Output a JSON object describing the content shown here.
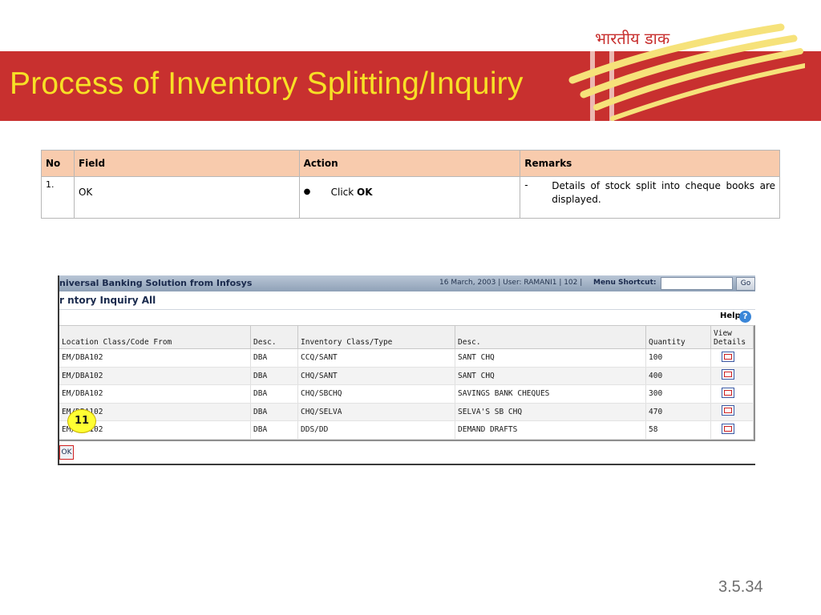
{
  "slide": {
    "title": "Process of Inventory Splitting/Inquiry",
    "logo_text": "भारतीय डाक",
    "page_number": "3.5.34",
    "colors": {
      "header_band": "#c8302f",
      "title_text": "#f7e026",
      "table_header": "#f8cbad"
    }
  },
  "instructions": {
    "headers": {
      "no": "No",
      "field": "Field",
      "action": "Action",
      "remarks": "Remarks"
    },
    "rows": [
      {
        "no": "1.",
        "field": "OK",
        "action_prefix": "Click ",
        "action_bold": "OK",
        "remark_dash": "-",
        "remark": "Details of stock split into cheque books are displayed."
      }
    ]
  },
  "app": {
    "title": "niversal Banking Solution from Infosys",
    "info": "16 March, 2003  |  User:  RAMANI1  |  102  |",
    "menu_shortcut_label": "Menu Shortcut:",
    "go_label": "Go",
    "subtitle": "r    ntory Inquiry All",
    "help_label": "Help",
    "help_icon": "?",
    "columns": [
      "Location Class/Code From",
      "Desc.",
      "Inventory Class/Type",
      "Desc.",
      "Quantity",
      "View Details"
    ],
    "rows": [
      {
        "loc": "EM/DBA102",
        "desc1": "DBA",
        "inv": "CCQ/SANT",
        "desc2": "SANT CHQ",
        "qty": "100"
      },
      {
        "loc": "EM/DBA102",
        "desc1": "DBA",
        "inv": "CHQ/SANT",
        "desc2": "SANT CHQ",
        "qty": "400"
      },
      {
        "loc": "EM/DBA102",
        "desc1": "DBA",
        "inv": "CHQ/SBCHQ",
        "desc2": "SAVINGS BANK CHEQUES",
        "qty": "300"
      },
      {
        "loc": "EM/DBA102",
        "desc1": "DBA",
        "inv": "CHQ/SELVA",
        "desc2": "SELVA'S SB CHQ",
        "qty": "470"
      },
      {
        "loc": "EM/DBA102",
        "desc1": "DBA",
        "inv": "DDS/DD",
        "desc2": "DEMAND DRAFTS",
        "qty": "58"
      }
    ],
    "ok_label": "OK",
    "step_badge": "11"
  }
}
